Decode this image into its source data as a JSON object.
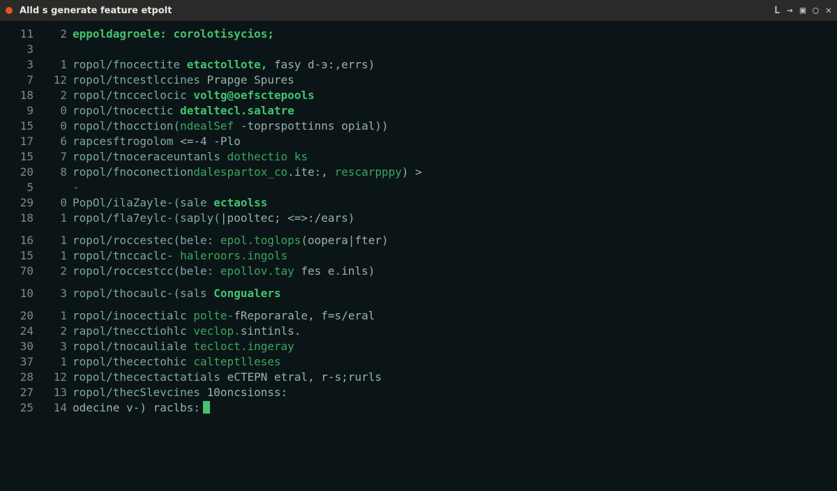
{
  "window": {
    "title": "Alld s generate feature etpolt",
    "controls": [
      "L",
      "→",
      "▣",
      "◯",
      "✕"
    ]
  },
  "rows": [
    {
      "a": "11",
      "b": "2",
      "segs": [
        {
          "cls": "c-key",
          "t": "eppoldagroele:"
        },
        {
          "cls": "c-text",
          "t": " "
        },
        {
          "cls": "c-key",
          "t": "corolotisycios;"
        }
      ]
    },
    {
      "a": "3",
      "b": "",
      "segs": []
    },
    {
      "a": "3",
      "b": "1",
      "segs": [
        {
          "cls": "c-path",
          "t": "ropol/fnocectite "
        },
        {
          "cls": "c-key",
          "t": "etactollote,"
        },
        {
          "cls": "c-text",
          "t": " fasy d-э:,errs)"
        }
      ]
    },
    {
      "a": "7",
      "b": "12",
      "segs": [
        {
          "cls": "c-path",
          "t": "ropol/tncestlccines "
        },
        {
          "cls": "c-text",
          "t": "Prapge Spures"
        }
      ]
    },
    {
      "a": "18",
      "b": "2",
      "segs": [
        {
          "cls": "c-path",
          "t": "ropol/tncceclocic "
        },
        {
          "cls": "c-key",
          "t": "voltg@oefsctepools"
        }
      ]
    },
    {
      "a": "9",
      "b": "0",
      "segs": [
        {
          "cls": "c-path",
          "t": "ropol/tnocectic "
        },
        {
          "cls": "c-key",
          "t": "detaltecl.salatre"
        }
      ]
    },
    {
      "a": "15",
      "b": "0",
      "segs": [
        {
          "cls": "c-path",
          "t": "ropol/thocction("
        },
        {
          "cls": "c-key2",
          "t": "ndealSef"
        },
        {
          "cls": "c-text",
          "t": " -toprspottinns opial))"
        }
      ]
    },
    {
      "a": "17",
      "b": "6",
      "segs": [
        {
          "cls": "c-path",
          "t": "rapcesftrogolom "
        },
        {
          "cls": "c-text",
          "t": "<=-4 -Plo"
        }
      ]
    },
    {
      "a": "15",
      "b": "7",
      "segs": [
        {
          "cls": "c-path",
          "t": "ropol/tnoceraceuntanls "
        },
        {
          "cls": "c-key2",
          "t": "dothectio ks"
        }
      ]
    },
    {
      "a": "20",
      "b": "8",
      "segs": [
        {
          "cls": "c-path",
          "t": "ropol/fnoconection"
        },
        {
          "cls": "c-key2",
          "t": "dalespartox_co"
        },
        {
          "cls": "c-text",
          "t": ".ite:, "
        },
        {
          "cls": "c-key2",
          "t": "rescarpppy"
        },
        {
          "cls": "c-text",
          "t": ") >"
        }
      ]
    },
    {
      "a": "5",
      "b": "",
      "segs": [
        {
          "cls": "c-dim",
          "t": "-"
        }
      ]
    },
    {
      "a": "29",
      "b": "0",
      "segs": [
        {
          "cls": "c-path",
          "t": "PopOl/ilaZayle-(sale "
        },
        {
          "cls": "c-key",
          "t": "ectaolss"
        }
      ]
    },
    {
      "a": "18",
      "b": "1",
      "segs": [
        {
          "cls": "c-path",
          "t": "ropol/fla7eylc-(saply("
        },
        {
          "cls": "c-text",
          "t": "|pooltec; <=>:/ears)"
        }
      ]
    },
    {
      "gap": true
    },
    {
      "a": "16",
      "b": "1",
      "segs": [
        {
          "cls": "c-path",
          "t": "ropol/roccestec(bele: "
        },
        {
          "cls": "c-key2",
          "t": "epol.toglops"
        },
        {
          "cls": "c-text",
          "t": "(oopera|fter)"
        }
      ]
    },
    {
      "a": "15",
      "b": "1",
      "segs": [
        {
          "cls": "c-path",
          "t": "ropol/tnccaclc- "
        },
        {
          "cls": "c-key2",
          "t": "haleroors.ingols"
        }
      ]
    },
    {
      "a": "70",
      "b": "2",
      "segs": [
        {
          "cls": "c-path",
          "t": "ropol/roccestcc(bele: "
        },
        {
          "cls": "c-key2",
          "t": "epollov.tay"
        },
        {
          "cls": "c-text",
          "t": " fes e.inls)"
        }
      ]
    },
    {
      "gap": true
    },
    {
      "a": "10",
      "b": "3",
      "segs": [
        {
          "cls": "c-path",
          "t": "ropol/thocaulc-(sals "
        },
        {
          "cls": "c-key",
          "t": "Congualers"
        }
      ]
    },
    {
      "gap": true
    },
    {
      "a": "20",
      "b": "1",
      "segs": [
        {
          "cls": "c-path",
          "t": "ropol/inocectialc "
        },
        {
          "cls": "c-key2",
          "t": "polte-"
        },
        {
          "cls": "c-text",
          "t": "fReporarale, f=s/eral"
        }
      ]
    },
    {
      "a": "24",
      "b": "2",
      "segs": [
        {
          "cls": "c-path",
          "t": "rapol/tnecctiohlc "
        },
        {
          "cls": "c-key2",
          "t": "veclop."
        },
        {
          "cls": "c-text",
          "t": "sintinls."
        }
      ]
    },
    {
      "a": "30",
      "b": "3",
      "segs": [
        {
          "cls": "c-path",
          "t": "ropol/tnocauliale "
        },
        {
          "cls": "c-key2",
          "t": "tecloct.ingeray"
        }
      ]
    },
    {
      "a": "37",
      "b": "1",
      "segs": [
        {
          "cls": "c-path",
          "t": "ropol/thecectohic "
        },
        {
          "cls": "c-key2",
          "t": "calteptlleses"
        }
      ]
    },
    {
      "a": "28",
      "b": "12",
      "segs": [
        {
          "cls": "c-path",
          "t": "ropol/thecectactatials "
        },
        {
          "cls": "c-text",
          "t": "eCTEPN etral, r-s;rurls"
        }
      ]
    },
    {
      "a": "27",
      "b": "13",
      "segs": [
        {
          "cls": "c-path",
          "t": "ropol/thecSlevcines "
        },
        {
          "cls": "c-text",
          "t": "10oncsionss:"
        }
      ]
    },
    {
      "a": "25",
      "b": "14",
      "segs": [
        {
          "cls": "c-text",
          "t": "odecine v-) raclbs:"
        }
      ],
      "cursor": true
    }
  ]
}
